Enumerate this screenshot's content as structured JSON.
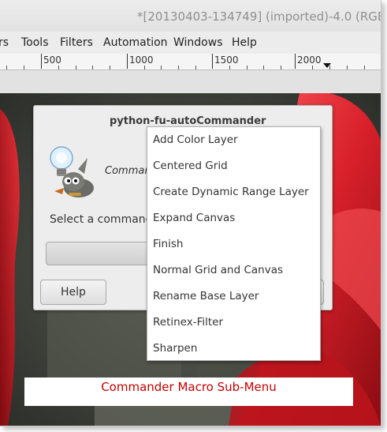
{
  "window": {
    "title": "*[20130403-134749] (imported)-4.0 (RGB"
  },
  "menubar": {
    "items": [
      "rs",
      "Tools",
      "Filters",
      "Automation",
      "Windows",
      "Help"
    ]
  },
  "ruler": {
    "labels": [
      "500",
      "1000",
      "1500",
      "2000"
    ]
  },
  "dialog": {
    "title": "python-fu-autoCommander",
    "heading": "Commander",
    "select_label": "Select a command",
    "help_button": "Help"
  },
  "popup_menu": {
    "items": [
      "Add Color Layer",
      "Centered Grid",
      "Create Dynamic Range Layer",
      "Expand Canvas",
      "Finish",
      "Normal Grid and Canvas",
      "Rename Base Layer",
      "Retinex-Filter",
      "Sharpen"
    ]
  },
  "caption": {
    "text": "Commander Macro Sub-Menu"
  },
  "colors": {
    "caption_text": "#c40000",
    "guide_dashes": "#d8c000",
    "tulip_red": "#d01a22"
  },
  "icons": {
    "dialog_icon": "gimp-wilber-with-lightbulb-icon",
    "ruler_marker": "triangle-down-icon"
  }
}
